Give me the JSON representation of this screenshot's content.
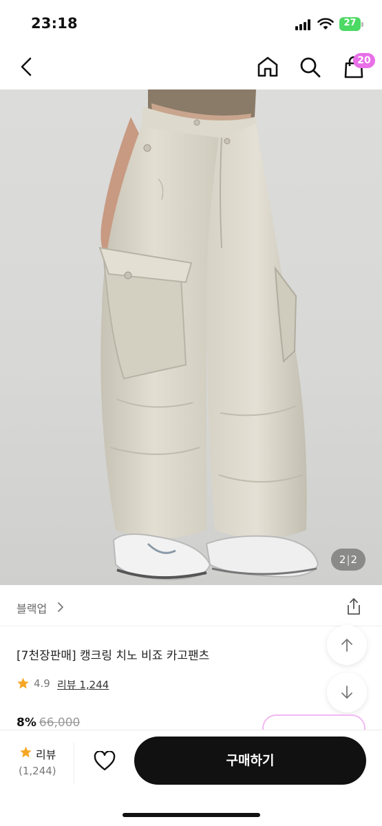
{
  "status_bar": {
    "time": "23:18",
    "battery": "27"
  },
  "nav": {
    "cart_count": "20"
  },
  "gallery": {
    "current": "2",
    "separator": "|",
    "total": "2"
  },
  "brand": {
    "name": "블랙업"
  },
  "product": {
    "title": "[7천장판매] 캥크링 치노 비죠 카고팬츠",
    "rating": "4.9",
    "review_link": "리뷰 1,244",
    "discount": "8%",
    "original_price": "66,000"
  },
  "bottom_bar": {
    "review_label": "리뷰",
    "review_count": "(1,244)",
    "buy_label": "구매하기"
  },
  "colors": {
    "accent": "#e86fe8",
    "star": "#f5a623",
    "buy_button": "#111111",
    "battery": "#4cd964"
  }
}
